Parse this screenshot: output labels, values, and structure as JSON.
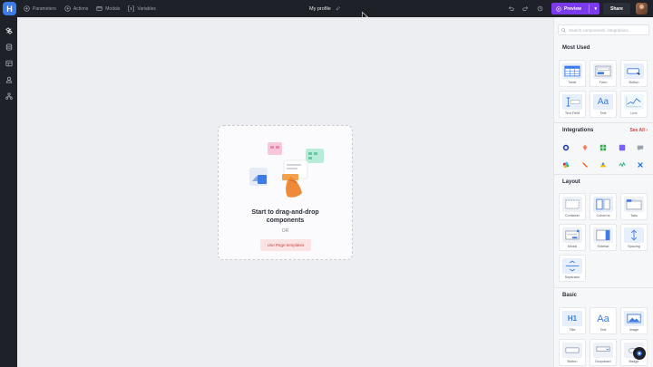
{
  "app": {
    "logo_letter": "H",
    "page_title": "My profile"
  },
  "topnav": [
    {
      "label": "Parameters",
      "icon": "parameters-icon"
    },
    {
      "label": "Actions",
      "icon": "actions-icon"
    },
    {
      "label": "Modals",
      "icon": "modals-icon"
    },
    {
      "label": "Variables",
      "icon": "variables-icon"
    }
  ],
  "toolbar": {
    "preview_label": "Preview",
    "share_label": "Share"
  },
  "canvas": {
    "drop_title_line1": "Start to drag-and-drop",
    "drop_title_line2": "components",
    "or_label": "OR",
    "templates_button": "Use Page templates"
  },
  "panel": {
    "search_placeholder": "Search components, integrations...",
    "most_used_title": "Most Used",
    "most_used": [
      "Table",
      "Form",
      "Button",
      "Text Field",
      "Text",
      "Line"
    ],
    "integrations_title": "Integrations",
    "see_all": "See All",
    "layout_title": "Layout",
    "layout": [
      "Container",
      "Columns",
      "Tabs",
      "Modal",
      "Sidebar",
      "Spacing",
      "Separator"
    ],
    "basic_title": "Basic",
    "basic": [
      "Title",
      "Text",
      "Image",
      "Button",
      "Dropdown",
      "Badge"
    ],
    "text_glyph": "Aa",
    "title_glyph": "H1"
  },
  "colors": {
    "accent": "#7c3aed",
    "brand": "#3d7be8",
    "danger": "#d0443f",
    "dark": "#1e2128"
  }
}
